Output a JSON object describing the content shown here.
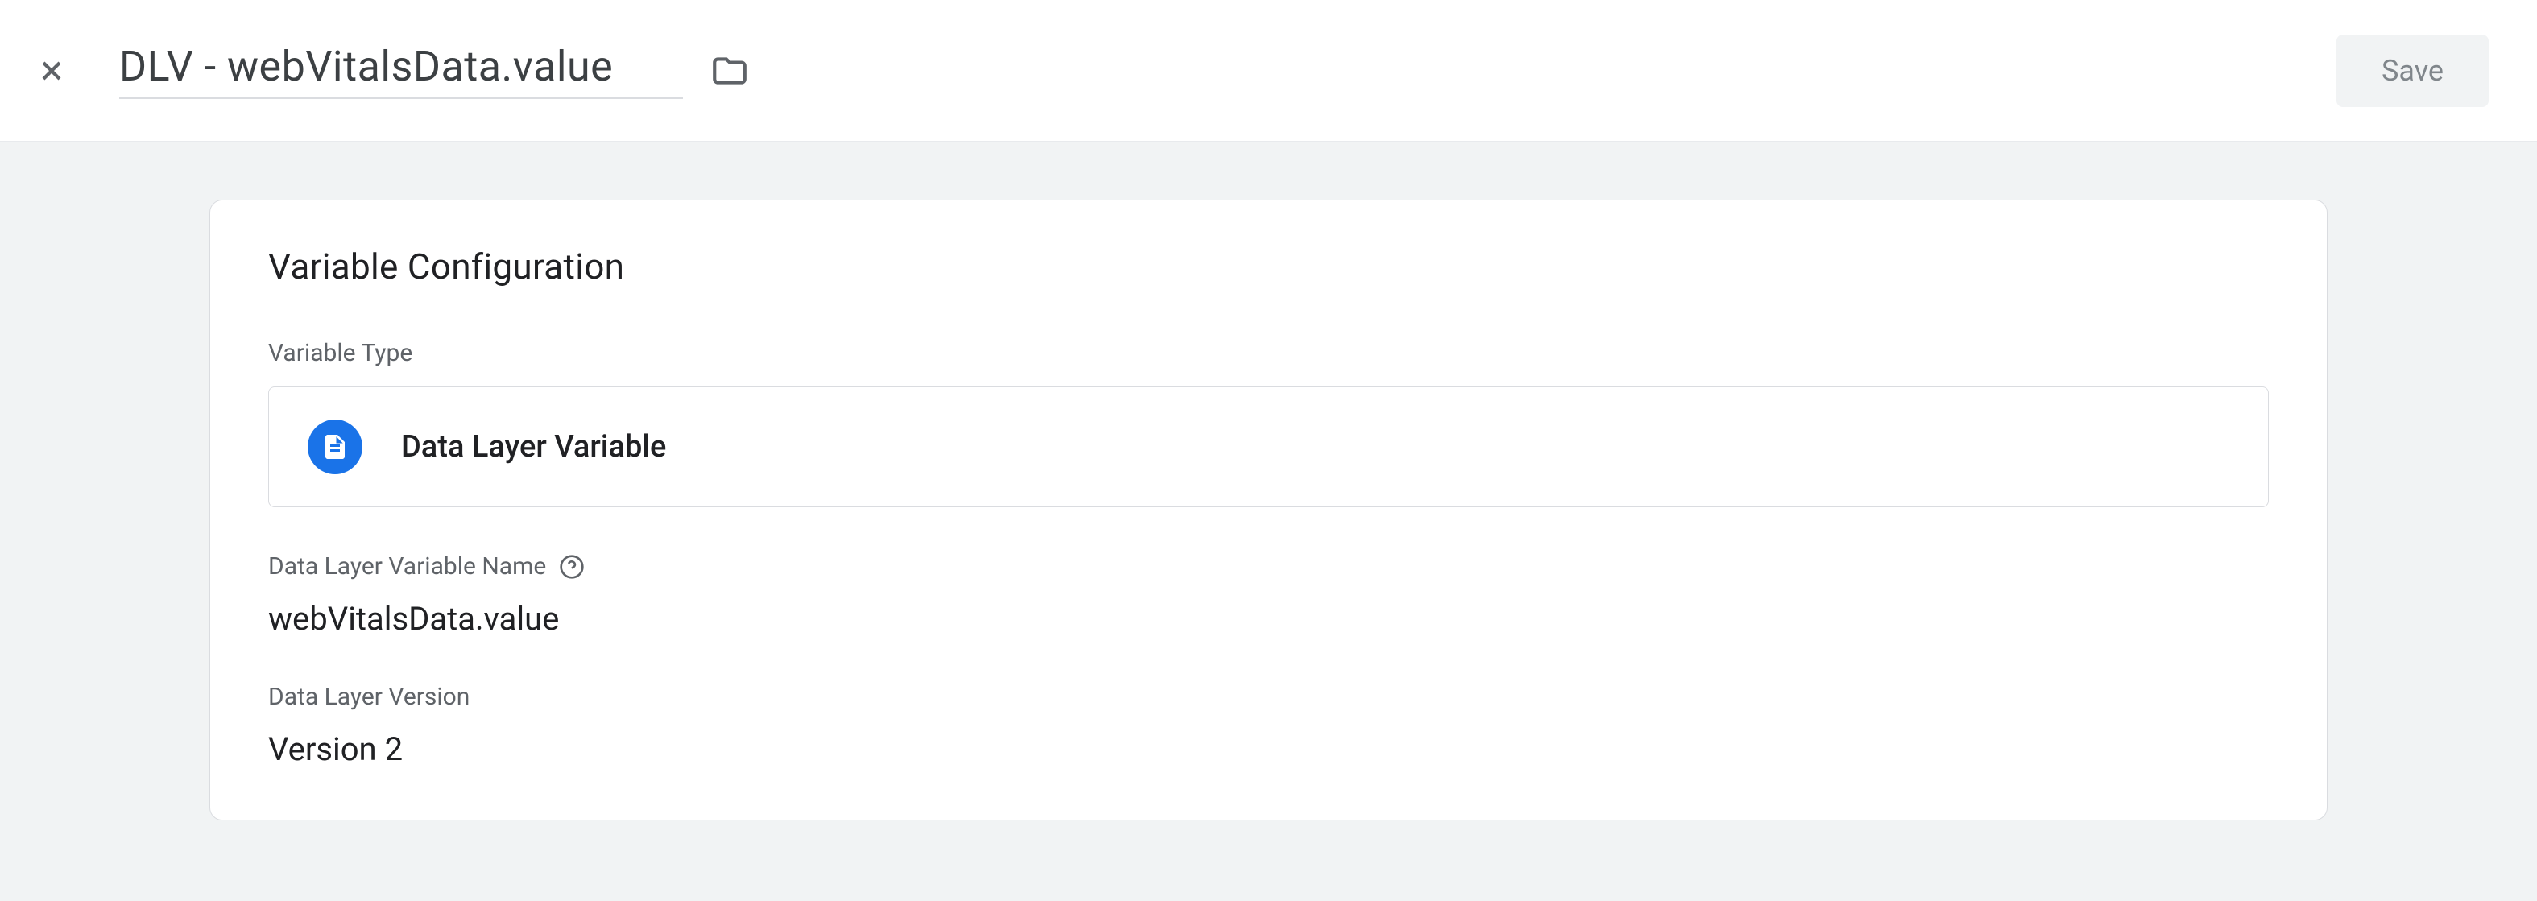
{
  "header": {
    "title": "DLV - webVitalsData.value",
    "save_label": "Save"
  },
  "card": {
    "title": "Variable Configuration",
    "variable_type": {
      "label": "Variable Type",
      "value": "Data Layer Variable"
    },
    "variable_name": {
      "label": "Data Layer Variable Name",
      "value": "webVitalsData.value"
    },
    "data_layer_version": {
      "label": "Data Layer Version",
      "value": "Version 2"
    }
  }
}
